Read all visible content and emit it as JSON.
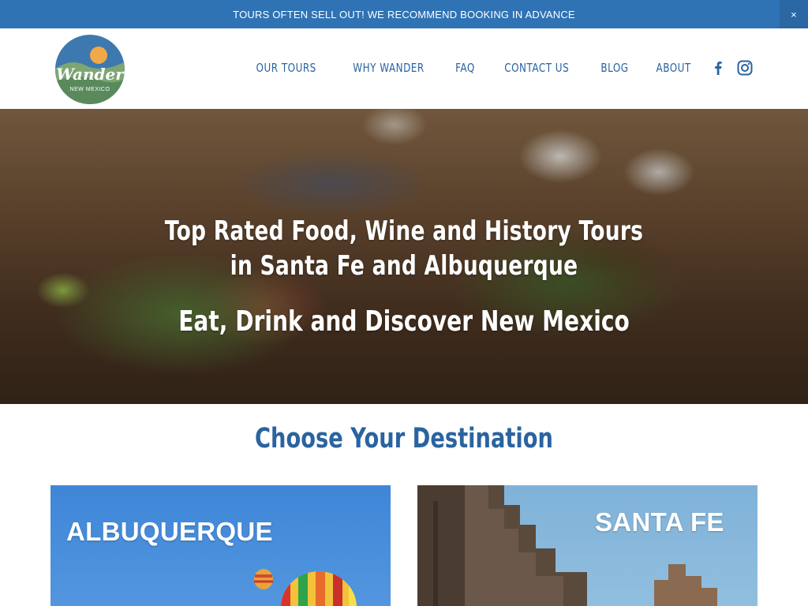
{
  "announcement": {
    "text": "TOURS OFTEN SELL OUT! WE RECOMMEND BOOKING IN ADVANCE",
    "close_label": "×"
  },
  "logo": {
    "wordmark": "Wander",
    "tagline": "NEW MEXICO"
  },
  "nav": {
    "items": [
      {
        "label": "OUR TOURS"
      },
      {
        "label": "WHY WANDER"
      },
      {
        "label": "FAQ"
      },
      {
        "label": "CONTACT US"
      },
      {
        "label": "BLOG"
      },
      {
        "label": "ABOUT"
      }
    ],
    "social": [
      "facebook-icon",
      "instagram-icon"
    ]
  },
  "hero": {
    "title": "Top Rated Food, Wine and History Tours in Santa Fe and Albuquerque",
    "subtitle": "Eat, Drink and Discover New Mexico"
  },
  "destinations": {
    "heading": "Choose Your Destination",
    "cards": [
      {
        "label": "ALBUQUERQUE"
      },
      {
        "label": "SANTA FE"
      }
    ]
  },
  "colors": {
    "brand_blue": "#2f73b5",
    "nav_text": "#2a63a0",
    "white": "#ffffff"
  }
}
